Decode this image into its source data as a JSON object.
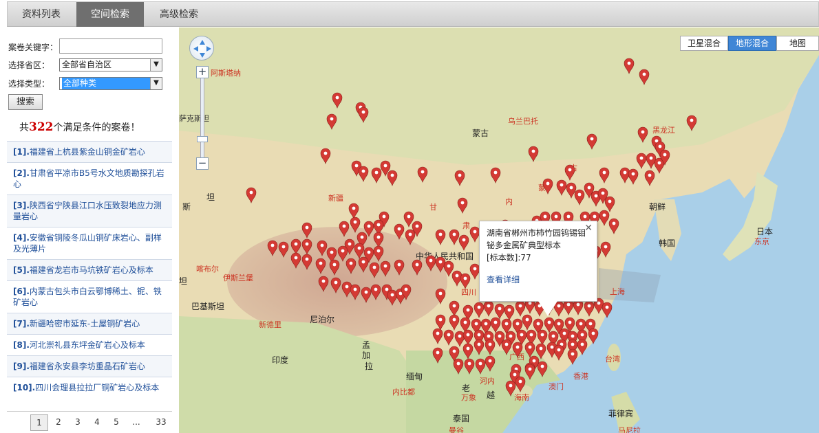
{
  "tabs": [
    {
      "label": "资料列表",
      "active": false
    },
    {
      "label": "空间检索",
      "active": true
    },
    {
      "label": "高级检索",
      "active": false
    }
  ],
  "search": {
    "keyword_label": "案卷关键字：",
    "keyword_value": "",
    "province_label": "选择省区：",
    "province_value": "全部省自治区",
    "type_label": "选择类型：",
    "type_value": "全部种类",
    "button": "搜索"
  },
  "result": {
    "prefix": "共",
    "count": "322",
    "suffix": "个满足条件的案卷！"
  },
  "list": [
    {
      "idx": "[1].",
      "text": "福建省上杭县紫金山铜金矿岩心"
    },
    {
      "idx": "[2].",
      "text": "甘肃省平凉市B5号水文地质勘探孔岩心"
    },
    {
      "idx": "[3].",
      "text": "陕西省宁陕县江口水压致裂地应力测量岩心"
    },
    {
      "idx": "[4].",
      "text": "安徽省铜陵冬瓜山铜矿床岩心、副样及光薄片"
    },
    {
      "idx": "[5].",
      "text": "福建省龙岩市马坑铁矿岩心及标本"
    },
    {
      "idx": "[6].",
      "text": "内蒙古包头市白云鄂博稀土、铌、铁矿岩心"
    },
    {
      "idx": "[7].",
      "text": "新疆哈密市延东-土屋铜矿岩心"
    },
    {
      "idx": "[8].",
      "text": "河北崇礼县东坪金矿岩心及标本"
    },
    {
      "idx": "[9].",
      "text": "福建省永安县李坊重晶石矿岩心"
    },
    {
      "idx": "[10].",
      "text": "四川会理县拉拉厂铜矿岩心及标本"
    }
  ],
  "pager": [
    "1",
    "2",
    "3",
    "4",
    "5",
    "...",
    "33"
  ],
  "map": {
    "types": [
      {
        "label": "卫星混合",
        "active": false
      },
      {
        "label": "地形混合",
        "active": true
      },
      {
        "label": "地图",
        "active": false
      }
    ],
    "zoom_in": "+",
    "zoom_out": "−",
    "popup": {
      "title": "湖南省郴州市柿竹园钨锡钼铋多金属矿典型标本",
      "count_text": "[标本数]:77",
      "link": "查看详细",
      "close": "✕"
    },
    "labels": [
      {
        "text": "阿斯塔纳",
        "color": "red"
      },
      {
        "text": "萨克斯坦",
        "color": "dark"
      },
      {
        "text": "乌兰巴托",
        "color": "red"
      },
      {
        "text": "蒙古",
        "color": "dark"
      },
      {
        "text": "黑龙江",
        "color": "red"
      },
      {
        "text": "新疆",
        "color": "red"
      },
      {
        "text": "斯",
        "color": "dark"
      },
      {
        "text": "坦",
        "color": "dark"
      },
      {
        "text": "古",
        "color": "red"
      },
      {
        "text": "蒙",
        "color": "red"
      },
      {
        "text": "内",
        "color": "red"
      },
      {
        "text": "甘",
        "color": "red"
      },
      {
        "text": "肃",
        "color": "red"
      },
      {
        "text": "朝鲜",
        "color": "dark"
      },
      {
        "text": "韩国",
        "color": "dark"
      },
      {
        "text": "日本",
        "color": "dark"
      },
      {
        "text": "东京",
        "color": "red"
      },
      {
        "text": "中华人民共和国",
        "color": "dark"
      },
      {
        "text": "喀布尔",
        "color": "red"
      },
      {
        "text": "伊斯兰堡",
        "color": "red"
      },
      {
        "text": "坦",
        "color": "dark"
      },
      {
        "text": "巴基斯坦",
        "color": "dark"
      },
      {
        "text": "新德里",
        "color": "red"
      },
      {
        "text": "尼泊尔",
        "color": "dark"
      },
      {
        "text": "四川",
        "color": "red"
      },
      {
        "text": "上海",
        "color": "red"
      },
      {
        "text": "孟",
        "color": "dark"
      },
      {
        "text": "加",
        "color": "dark"
      },
      {
        "text": "拉",
        "color": "dark"
      },
      {
        "text": "印度",
        "color": "dark"
      },
      {
        "text": "缅甸",
        "color": "dark"
      },
      {
        "text": "广西",
        "color": "red"
      },
      {
        "text": "台湾",
        "color": "red"
      },
      {
        "text": "香港",
        "color": "red"
      },
      {
        "text": "澳门",
        "color": "red"
      },
      {
        "text": "河内",
        "color": "red"
      },
      {
        "text": "老",
        "color": "dark"
      },
      {
        "text": "万象",
        "color": "red"
      },
      {
        "text": "越",
        "color": "dark"
      },
      {
        "text": "海南",
        "color": "red"
      },
      {
        "text": "内比都",
        "color": "red"
      },
      {
        "text": "泰国",
        "color": "dark"
      },
      {
        "text": "菲律宾",
        "color": "dark"
      },
      {
        "text": "曼谷",
        "color": "red"
      },
      {
        "text": "马尼拉",
        "color": "red"
      }
    ],
    "colors": {
      "water": "#a9cfe8",
      "land": "#e9dcb4",
      "marker": "#d43a34",
      "accent": "#3f86d6"
    }
  }
}
